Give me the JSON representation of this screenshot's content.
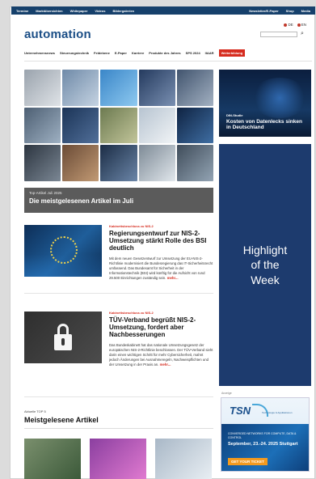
{
  "topbar": {
    "left_links": [
      "Termine",
      "Marktübersichten",
      "Whitepaper",
      "Videos",
      "Bildergalerien"
    ],
    "right_links": [
      "Newsletter/E-Paper",
      "Shop",
      "Media"
    ]
  },
  "brand": {
    "logo_text": "automation",
    "languages": [
      "DE",
      "EN"
    ],
    "search_placeholder": ""
  },
  "mainnav": [
    "Unternehmensnews",
    "Steuerungstechnik",
    "Feldebene",
    "E-Paper",
    "Karriere",
    "Produkte des Jahres",
    "SPS 2024",
    "IIAAR",
    "Weiterbildung"
  ],
  "featured_header": {
    "kicker": "Top-Artikel Juli 2025",
    "title": "Die meistgelesenen Artikel im Juli"
  },
  "articles": [
    {
      "kicker": "Kabinettsbeschluss zu NIS-2",
      "title": "Regierungsentwurf zur NIS-2-Umsetzung stärkt Rolle des BSI deutlich",
      "excerpt": "Mit dem neuen Gesetzentwurf zur Umsetzung der EU-NIS-2-Richtlinie modernisiert die Bundesregierung das IT-Sicherheitsrecht umfassend. Das Bundesamt für Sicherheit in der Informationstechnik (BSI) wird künftig für die Aufsicht von rund 29.500 Einrichtungen zuständig sein.",
      "more": "mehr..."
    },
    {
      "kicker": "Kabinettsbeschluss zu NIS-2",
      "title": "TÜV-Verband begrüßt NIS-2-Umsetzung, fordert aber Nachbesserungen",
      "excerpt": "Das Bundeskabinett hat das nationale Umsetzungsgesetz der europäischen NIS-2-Richtlinie beschlossen. Der TÜV-Verband sieht darin einen wichtigen Schritt für mehr Cybersicherheit, mahnt jedoch Änderungen bei Ausnahmeregeln, Nachweispflichten und der Umsetzung in der Praxis an.",
      "more": "mehr..."
    }
  ],
  "top5": {
    "kicker": "Aktuelle TOP 5",
    "title": "Meistgelesene Artikel"
  },
  "sidebar": {
    "ad1_kicker": "DIN-Studie",
    "ad1_title": "Kosten von Datenlecks sinken in Deutschland",
    "highlight": "Highlight of the Week",
    "anzeige": "Anzeige",
    "tsn_logo": "TSN",
    "tsn_sub": "Technologie & Applikationen",
    "tsn_event": "CONVERGED NETWORKS FOR COMPUTE, DATA & CONTROL",
    "tsn_date": "September, 23.-24. 2025 Stuttgart",
    "tsn_cta": "GET YOUR TICKET"
  }
}
